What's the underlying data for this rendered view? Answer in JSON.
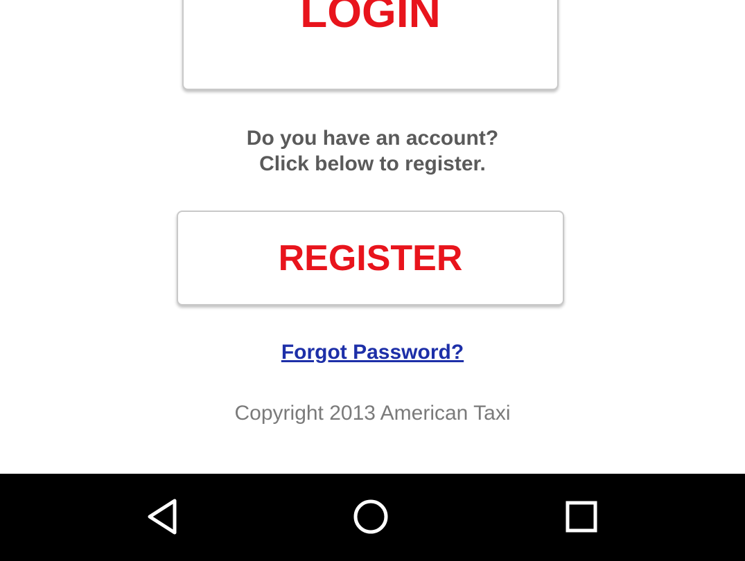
{
  "login": {
    "label": "LOGIN"
  },
  "prompt": {
    "line1": "Do you have an account?",
    "line2": "Click below to register."
  },
  "register": {
    "label": "REGISTER"
  },
  "forgot_password": {
    "label": "Forgot Password?"
  },
  "copyright": {
    "text": "Copyright 2013 American Taxi"
  },
  "navbar": {
    "back_icon": "back-triangle-icon",
    "home_icon": "home-circle-icon",
    "recent_icon": "recent-apps-square-icon"
  },
  "colors": {
    "button_text": "#e8141c",
    "link": "#1d2fa8",
    "prompt_text": "#5a5a5a",
    "copyright_text": "#7a7a7a",
    "navbar_bg": "#000000"
  }
}
